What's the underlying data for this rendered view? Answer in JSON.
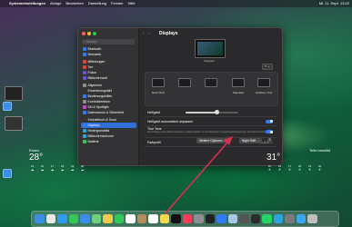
{
  "menubar": {
    "apple": "",
    "app": "Systemeinstellungen",
    "items": [
      "Ablage",
      "Bearbeiten",
      "Darstellung",
      "Fenster",
      "Hilfe"
    ],
    "clock": "Mi. 11. Sept. 13:22"
  },
  "sidebar": {
    "search_placeholder": "Suchen",
    "items": [
      {
        "label": "Bluetooth",
        "color": "#2f7cf6"
      },
      {
        "label": "Netzwerk",
        "color": "#2f7cf6"
      },
      {
        "label": "Mitteilungen",
        "color": "#e0453a"
      },
      {
        "label": "Ton",
        "color": "#e0453a"
      },
      {
        "label": "Fokus",
        "color": "#6a4fd8"
      },
      {
        "label": "Bildschirmzeit",
        "color": "#6a4fd8"
      },
      {
        "label": "Allgemein",
        "color": "#8e8e93"
      },
      {
        "label": "Erscheinungsbild",
        "color": "#333"
      },
      {
        "label": "Bedienungshilfen",
        "color": "#2f7cf6"
      },
      {
        "label": "Kontrollzentrum",
        "color": "#8e8e93"
      },
      {
        "label": "Siri & Spotlight",
        "color": "#c04bd8"
      },
      {
        "label": "Datenschutz & Sicherheit",
        "color": "#2f7cf6"
      },
      {
        "label": "Schreibtisch & Dock",
        "color": "#333"
      },
      {
        "label": "Displays",
        "color": "#2f7cf6"
      },
      {
        "label": "Hintergrundbild",
        "color": "#29a7d6"
      },
      {
        "label": "Bildschirmschoner",
        "color": "#29a7d6"
      },
      {
        "label": "Batterie",
        "color": "#34c759"
      }
    ],
    "selected": "Displays"
  },
  "display": {
    "title": "Displays",
    "nav_back": "‹",
    "nav_forward": "›",
    "display_name": "Integriert",
    "add_button": "+ ⌄",
    "resolutions": [
      {
        "label": "Mehr Platz"
      },
      {
        "label": "Standard"
      },
      {
        "label": "Größerer Text"
      }
    ],
    "brightness_label": "Helligkeit",
    "brightness_value": 0.6,
    "auto_brightness_label": "Helligkeit automatisch anpassen",
    "auto_brightness": true,
    "true_tone_label": "True Tone",
    "true_tone_desc": "Das Display automatisch anpassen, sodass Farben in verschiedenen Umgebungsbedingungen einheitlich erscheinen.",
    "true_tone": true,
    "profile_label": "Farbprofil",
    "profile_value": "Farb-LCD ⌄",
    "advanced_button": "Weitere Optionen ...",
    "nightshift_button": "Night Shift ...",
    "help": "?"
  },
  "weather": {
    "left": {
      "city": "Essen",
      "temp": "28°",
      "forecast": [
        {
          "t": "15",
          "i": "☁"
        },
        {
          "t": "16",
          "i": "☁"
        },
        {
          "t": "17",
          "i": "☁"
        },
        {
          "t": "18",
          "i": "☁"
        },
        {
          "t": "19",
          "i": "☁"
        },
        {
          "t": "20",
          "i": "☁"
        }
      ]
    },
    "right": {
      "city": "Teile bewölkt",
      "temp": "31°",
      "forecast": [
        {
          "t": "15",
          "i": "☀"
        },
        {
          "t": "16",
          "i": "☀"
        },
        {
          "t": "17",
          "i": "☀"
        },
        {
          "t": "18",
          "i": "☀"
        },
        {
          "t": "19",
          "i": "☀"
        },
        {
          "t": "20",
          "i": "☀"
        }
      ]
    }
  },
  "dock": {
    "apps": [
      {
        "name": "Finder",
        "color": "#3a8ee6"
      },
      {
        "name": "Launchpad",
        "color": "#e8e8e8"
      },
      {
        "name": "Safari",
        "color": "#2f9bf0"
      },
      {
        "name": "Nachrichten",
        "color": "#34c759"
      },
      {
        "name": "Mail",
        "color": "#3a8ee6"
      },
      {
        "name": "Karten",
        "color": "#6fcf7f"
      },
      {
        "name": "Fotos",
        "color": "#f2c94c"
      },
      {
        "name": "FaceTime",
        "color": "#34c759"
      },
      {
        "name": "Kalender",
        "color": "#ffffff"
      },
      {
        "name": "Kontakte",
        "color": "#b38b5d"
      },
      {
        "name": "Erinnerungen",
        "color": "#ffffff"
      },
      {
        "name": "Notizen",
        "color": "#f7d94c"
      },
      {
        "name": "TV",
        "color": "#111111"
      },
      {
        "name": "Musik",
        "color": "#fa3c5a"
      },
      {
        "name": "Systemeinstellungen",
        "color": "#8e8e93"
      },
      {
        "name": "Terminal",
        "color": "#222222"
      },
      {
        "name": "App Store",
        "color": "#2f7cf6"
      },
      {
        "name": "Vorschau",
        "color": "#a9c8e8"
      },
      {
        "name": "Rechner",
        "color": "#555555"
      },
      {
        "name": "Aktivitätsanzeige",
        "color": "#2c2c2c"
      },
      {
        "name": "WhatsApp",
        "color": "#25d366"
      },
      {
        "name": "Telegram",
        "color": "#2aa3e0"
      },
      {
        "name": "Bildschirmfoto",
        "color": "#7a7a7a"
      },
      {
        "name": "Downloads",
        "color": "#3aa8f0"
      },
      {
        "name": "Papierkorb",
        "color": "#bfbfbf"
      }
    ]
  },
  "annotation": {
    "arrow_color": "#d9304f"
  }
}
